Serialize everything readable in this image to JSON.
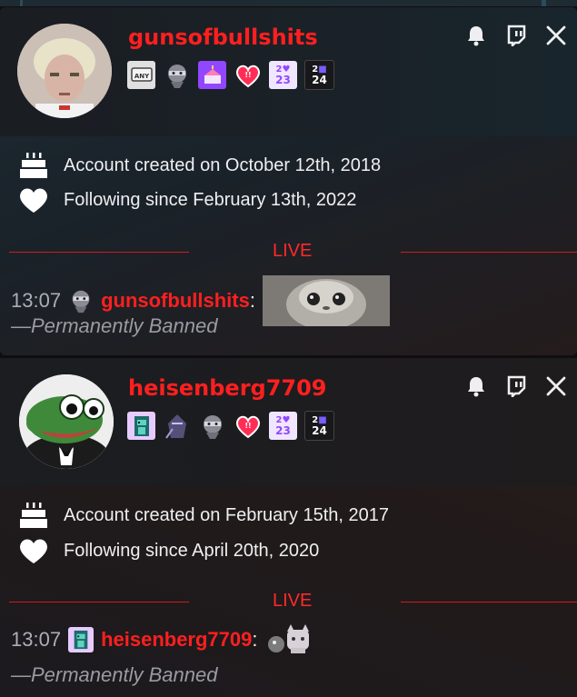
{
  "cards": [
    {
      "username": "gunsofbullshits",
      "badges": [
        {
          "icon": "any-key-badge-icon",
          "text": "ANY",
          "color": "#dcdcdc"
        },
        {
          "icon": "ninja-badge-icon",
          "text": "",
          "color": "#8c8c96"
        },
        {
          "icon": "cake-badge-icon",
          "text": "",
          "color": "#9147ff"
        },
        {
          "icon": "heart-badge-icon",
          "text": "",
          "color": "#ff2d55"
        },
        {
          "icon": "2023-badge-icon",
          "text": "23",
          "color": "#b06bff"
        },
        {
          "icon": "2024-badge-icon",
          "text": "24",
          "color": "#1f1f23"
        }
      ],
      "created": "Account created on October 12th, 2018",
      "following": "Following since February 13th, 2022",
      "live_label": "LIVE",
      "chat": {
        "time": "13:07",
        "name": "gunsofbullshits",
        "colon": ":",
        "badge_icon": "ninja-badge-icon"
      },
      "banned": "—Permanently Banned"
    },
    {
      "username": "heisenberg7709",
      "badges": [
        {
          "icon": "pixel-creature-badge-icon",
          "text": "",
          "color": "#e7cbff"
        },
        {
          "icon": "shadow-ninja-badge-icon",
          "text": "",
          "color": "#6a5a8c"
        },
        {
          "icon": "ninja-badge-icon",
          "text": "",
          "color": "#8c8c96"
        },
        {
          "icon": "heart-badge-icon",
          "text": "",
          "color": "#ff2d55"
        },
        {
          "icon": "2023-badge-icon",
          "text": "23",
          "color": "#b06bff"
        },
        {
          "icon": "2024-badge-icon",
          "text": "24",
          "color": "#1f1f23"
        }
      ],
      "created": "Account created on February 15th, 2017",
      "following": "Following since April 20th, 2020",
      "live_label": "LIVE",
      "chat": {
        "time": "13:07",
        "name": "heisenberg7709",
        "colon": ":",
        "badge_icon": "pixel-creature-badge-icon"
      },
      "banned": "—Permanently Banned"
    }
  ],
  "colors": {
    "username": "#ff1f1f",
    "live": "#ff2a2a",
    "banned": "#9a9aa3"
  }
}
